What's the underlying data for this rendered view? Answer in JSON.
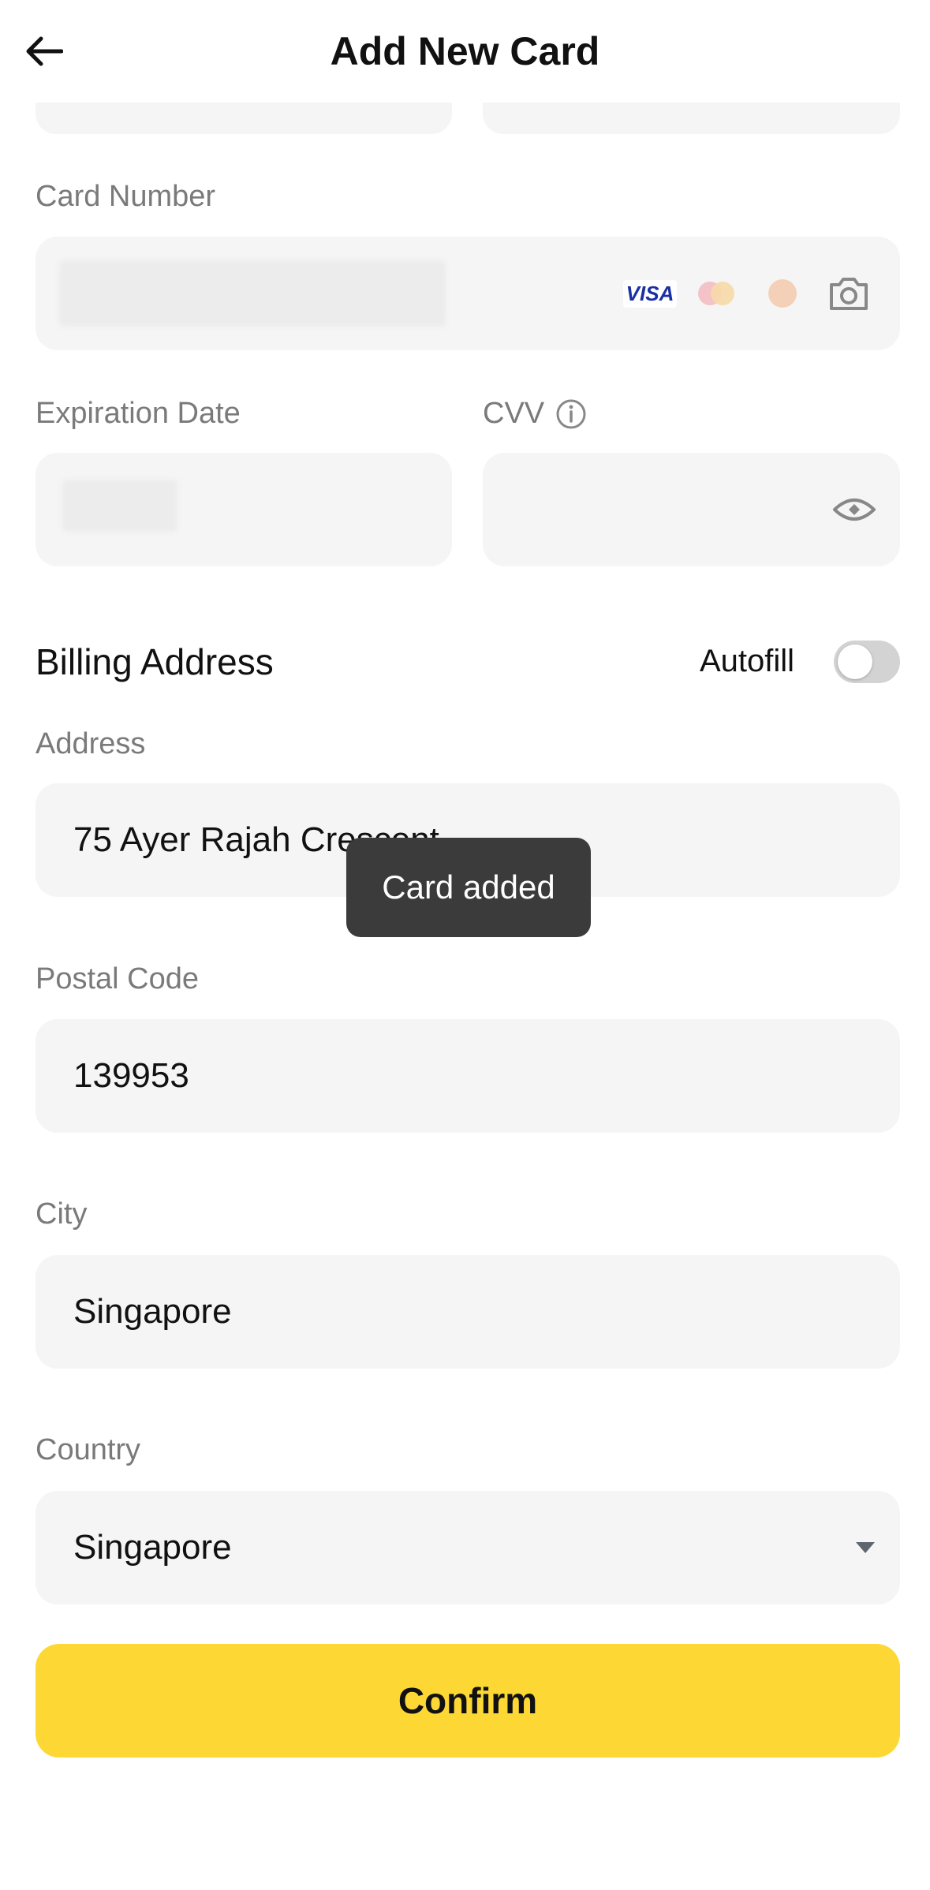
{
  "header": {
    "title": "Add New Card",
    "back_icon": "arrow-left-icon"
  },
  "card_number": {
    "label": "Card Number",
    "brands": [
      "VISA",
      "mastercard",
      "card-brand",
      "camera-icon"
    ]
  },
  "expiration": {
    "label": "Expiration Date"
  },
  "cvv": {
    "label": "CVV",
    "info_icon": "info-icon",
    "visibility_icon": "eye-icon"
  },
  "billing": {
    "title": "Billing Address",
    "autofill_label": "Autofill",
    "autofill_on": false
  },
  "address": {
    "label": "Address",
    "value": "75 Ayer Rajah Crescent"
  },
  "postal_code": {
    "label": "Postal Code",
    "value": "139953"
  },
  "city": {
    "label": "City",
    "value": "Singapore"
  },
  "country": {
    "label": "Country",
    "value": "Singapore"
  },
  "toast": {
    "message": "Card added"
  },
  "actions": {
    "confirm_label": "Confirm"
  },
  "colors": {
    "accent": "#fdd835",
    "field_bg": "#f5f5f5",
    "label": "#7a7a7a",
    "toast_bg": "#3b3b3b"
  }
}
